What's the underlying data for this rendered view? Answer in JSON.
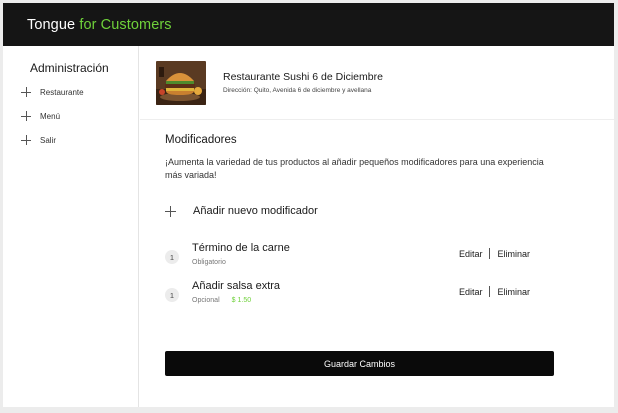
{
  "app": {
    "brand_main": "Tongue ",
    "brand_accent": "for Customers",
    "accent_color": "#6fd13a"
  },
  "sidebar": {
    "title": "Administración",
    "items": [
      {
        "icon": "plus-icon",
        "label": "Restaurante"
      },
      {
        "icon": "plus-icon",
        "label": "Menú"
      },
      {
        "icon": "plus-icon",
        "label": "Salir"
      }
    ]
  },
  "restaurant": {
    "name": "Restaurante Sushi 6 de Diciembre",
    "address": "Dirección: Quito, Avenida 6 de diciembre y avellana",
    "image": "burger-photo"
  },
  "modifiers": {
    "title": "Modificadores",
    "description": "¡Aumenta la variedad de tus productos al añadir pequeños modificadores para una experiencia más variada!",
    "add_label": "Añadir nuevo modificador",
    "items": [
      {
        "index": "1",
        "name": "Término de la carne",
        "type": "Obligatorio",
        "price": "",
        "edit_label": "Editar",
        "delete_label": "Eliminar"
      },
      {
        "index": "1",
        "name": "Añadir salsa extra",
        "type": "Opcional",
        "price": "$ 1.50",
        "edit_label": "Editar",
        "delete_label": "Eliminar"
      }
    ]
  },
  "save_button": "Guardar Cambios"
}
